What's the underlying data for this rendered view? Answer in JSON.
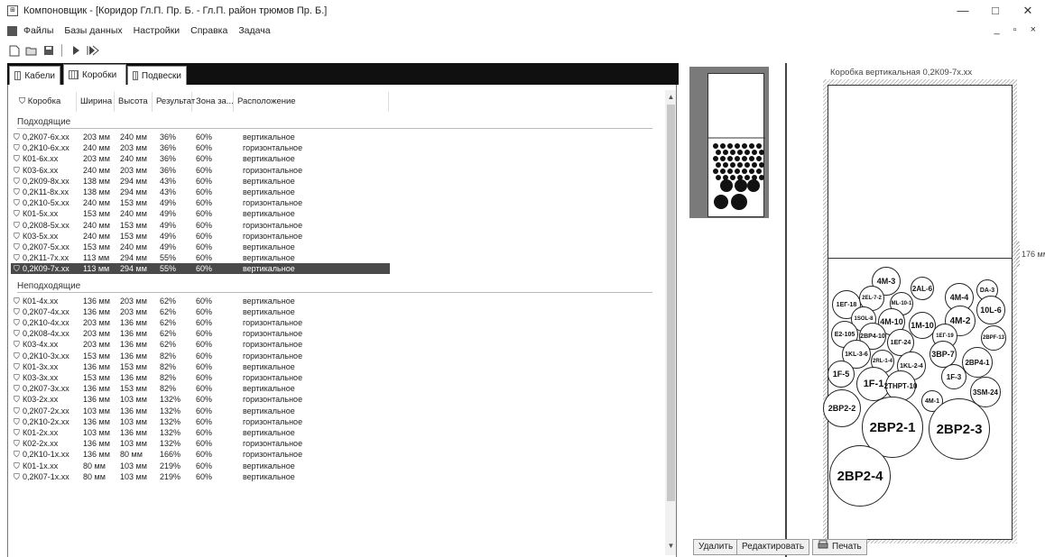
{
  "window": {
    "title": "Компоновщик - [Коридор Гл.П. Пр. Б. - Гл.П. район трюмов Пр. Б.]",
    "minimize": "—",
    "maximize": "□",
    "close": "✕"
  },
  "menu": {
    "items": [
      "Файлы",
      "Базы данных",
      "Настройки",
      "Справка",
      "Задача"
    ],
    "mdi_controls": "_ ▫ ×"
  },
  "toolbar": {
    "icons": [
      "new-icon",
      "open-icon",
      "save-icon",
      "run-icon",
      "run-all-icon"
    ]
  },
  "tabs": [
    {
      "label": "Кабели",
      "active": false
    },
    {
      "label": "Коробки",
      "active": true
    },
    {
      "label": "Подвески",
      "active": false
    }
  ],
  "table": {
    "columns": [
      "Коробка",
      "Ширина",
      "Высота",
      "Результат",
      "Зона за...",
      "Расположение"
    ],
    "groups": [
      {
        "name": "Подходящие",
        "rows": [
          [
            "0,2К07-6x.xx",
            "203 мм",
            "240 мм",
            "36%",
            "60%",
            "вертикальное"
          ],
          [
            "0,2К10-6x.xx",
            "240 мм",
            "203 мм",
            "36%",
            "60%",
            "горизонтальное"
          ],
          [
            "К01-6x.xx",
            "203 мм",
            "240 мм",
            "36%",
            "60%",
            "вертикальное"
          ],
          [
            "К03-6x.xx",
            "240 мм",
            "203 мм",
            "36%",
            "60%",
            "горизонтальное"
          ],
          [
            "0,2К09-8x.xx",
            "138 мм",
            "294 мм",
            "43%",
            "60%",
            "вертикальное"
          ],
          [
            "0,2К11-8x.xx",
            "138 мм",
            "294 мм",
            "43%",
            "60%",
            "вертикальное"
          ],
          [
            "0,2К10-5x.xx",
            "240 мм",
            "153 мм",
            "49%",
            "60%",
            "горизонтальное"
          ],
          [
            "К01-5x.xx",
            "153 мм",
            "240 мм",
            "49%",
            "60%",
            "вертикальное"
          ],
          [
            "0,2К08-5x.xx",
            "240 мм",
            "153 мм",
            "49%",
            "60%",
            "горизонтальное"
          ],
          [
            "К03-5x.xx",
            "240 мм",
            "153 мм",
            "49%",
            "60%",
            "горизонтальное"
          ],
          [
            "0,2К07-5x.xx",
            "153 мм",
            "240 мм",
            "49%",
            "60%",
            "вертикальное"
          ],
          [
            "0,2К11-7x.xx",
            "113 мм",
            "294 мм",
            "55%",
            "60%",
            "вертикальное"
          ],
          [
            "0,2К09-7x.xx",
            "113 мм",
            "294 мм",
            "55%",
            "60%",
            "вертикальное"
          ]
        ]
      },
      {
        "name": "Неподходящие",
        "rows": [
          [
            "К01-4x.xx",
            "136 мм",
            "203 мм",
            "62%",
            "60%",
            "вертикальное"
          ],
          [
            "0,2К07-4x.xx",
            "136 мм",
            "203 мм",
            "62%",
            "60%",
            "вертикальное"
          ],
          [
            "0,2К10-4x.xx",
            "203 мм",
            "136 мм",
            "62%",
            "60%",
            "горизонтальное"
          ],
          [
            "0,2К08-4x.xx",
            "203 мм",
            "136 мм",
            "62%",
            "60%",
            "горизонтальное"
          ],
          [
            "К03-4x.xx",
            "203 мм",
            "136 мм",
            "62%",
            "60%",
            "горизонтальное"
          ],
          [
            "0,2К10-3x.xx",
            "153 мм",
            "136 мм",
            "82%",
            "60%",
            "горизонтальное"
          ],
          [
            "К01-3x.xx",
            "136 мм",
            "153 мм",
            "82%",
            "60%",
            "вертикальное"
          ],
          [
            "К03-3x.xx",
            "153 мм",
            "136 мм",
            "82%",
            "60%",
            "горизонтальное"
          ],
          [
            "0,2К07-3x.xx",
            "136 мм",
            "153 мм",
            "82%",
            "60%",
            "вертикальное"
          ],
          [
            "К03-2x.xx",
            "136 мм",
            "103 мм",
            "132%",
            "60%",
            "горизонтальное"
          ],
          [
            "0,2К07-2x.xx",
            "103 мм",
            "136 мм",
            "132%",
            "60%",
            "вертикальное"
          ],
          [
            "0,2К10-2x.xx",
            "136 мм",
            "103 мм",
            "132%",
            "60%",
            "горизонтальное"
          ],
          [
            "К01-2x.xx",
            "103 мм",
            "136 мм",
            "132%",
            "60%",
            "вертикальное"
          ],
          [
            "К02-2x.xx",
            "136 мм",
            "103 мм",
            "132%",
            "60%",
            "горизонтальное"
          ],
          [
            "0,2К10-1x.xx",
            "136 мм",
            "80 мм",
            "166%",
            "60%",
            "горизонтальное"
          ],
          [
            "К01-1x.xx",
            "80 мм",
            "103 мм",
            "219%",
            "60%",
            "вертикальное"
          ],
          [
            "0,2К07-1x.xx",
            "80 мм",
            "103 мм",
            "219%",
            "60%",
            "вертикальное"
          ]
        ]
      }
    ],
    "selected": "0,2К09-7x.xx"
  },
  "preview": {
    "box_title": "Коробка вертикальная 0,2К09-7x.xx",
    "dimension_label": "176 мм",
    "cables": [
      "4М-3",
      "2AL-6",
      "4М-4",
      "DA-3",
      "1ЕГ-18",
      "2EL-7-2",
      "ML-10-1",
      "10L-6",
      "1SOL-8",
      "4М-10",
      "1М-10",
      "4М-2",
      "E2-105",
      "2ВР4-10",
      "1ЕГ-24",
      "1ЕГ-19",
      "2BPF-13",
      "1KL-3-6",
      "2RL-1-4",
      "1KL-2-4",
      "3ВР-7",
      "2ВР4-1",
      "1F-5",
      "1F-1",
      "2ТНРТ-10",
      "1F-3",
      "3SM-24",
      "4М-1",
      "2ВР2-2",
      "2ВР2-1",
      "2ВР2-3",
      "2ВР2-4"
    ]
  },
  "buttons": {
    "delete": "Удалить",
    "edit": "Редактировать",
    "print": "Печать"
  },
  "colors": {
    "selection": "#4a4a4a",
    "tabstrip": "#101010",
    "frame": "#7a7a7a"
  }
}
